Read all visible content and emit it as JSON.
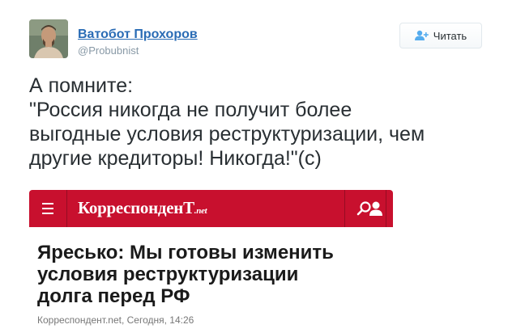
{
  "tweet": {
    "author_name": "Ватобот Прохоров",
    "author_handle": "@Probubnist",
    "follow_label": "Читать",
    "text": "А помните:\n\"Россия никогда не получит более\nвыгодные условия реструктуризации, чем\nдругие кредиторы! Никогда!\"(с)"
  },
  "card": {
    "logo_main": "КорреспонденТ",
    "logo_domain": ".net",
    "headline": "Яресько: Мы готовы изменить\nусловия реструктуризации\nдолга перед РФ",
    "meta": "Корреспондент.net, Сегодня, 14:26",
    "header_color": "#c8102e"
  },
  "icons": {
    "follow": "add-user-icon",
    "menu": "hamburger-icon",
    "search": "search-icon",
    "profile": "user-icon"
  }
}
